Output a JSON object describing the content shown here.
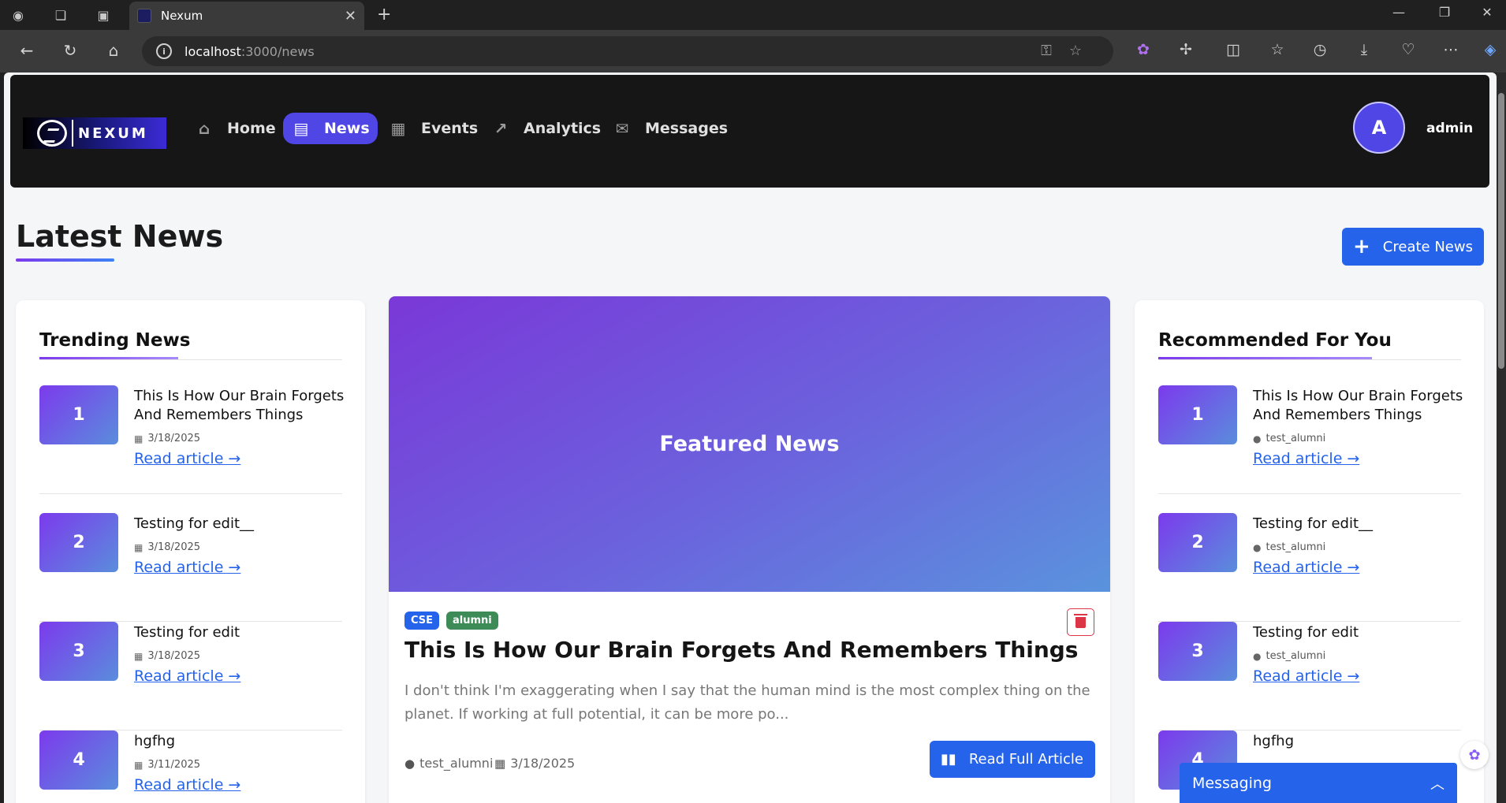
{
  "browser": {
    "tab_title": "Nexum",
    "tab_close": "✕",
    "new_tab": "+",
    "url_host": "localhost",
    "url_path": ":3000/news",
    "win_min": "—",
    "win_max": "❐",
    "win_close": "✕"
  },
  "nav": {
    "logo_text": "NEXUM",
    "items": [
      {
        "label": "Home",
        "icon": "home-icon",
        "glyph": "⌂"
      },
      {
        "label": "News",
        "icon": "newspaper-icon",
        "glyph": "▤"
      },
      {
        "label": "Events",
        "icon": "calendar-icon",
        "glyph": "▦"
      },
      {
        "label": "Analytics",
        "icon": "chart-line-icon",
        "glyph": "↗"
      },
      {
        "label": "Messages",
        "icon": "envelope-icon",
        "glyph": "✉"
      }
    ],
    "active": "News",
    "avatar_letter": "A",
    "username": "admin"
  },
  "page": {
    "title": "Latest News",
    "create_button": "Create News",
    "create_icon": "+"
  },
  "trending": {
    "title": "Trending News",
    "items": [
      {
        "rank": "1",
        "title": "This Is How Our Brain Forgets And Remembers Things",
        "meta": "3/18/2025",
        "link": "Read article →"
      },
      {
        "rank": "2",
        "title": "Testing for edit__",
        "meta": "3/18/2025",
        "link": "Read article →"
      },
      {
        "rank": "3",
        "title": "Testing for edit",
        "meta": "3/18/2025",
        "link": "Read article →"
      },
      {
        "rank": "4",
        "title": "hgfhg",
        "meta": "3/11/2025",
        "link": "Read article →"
      }
    ]
  },
  "featured": {
    "hero_label": "Featured News",
    "tags": [
      {
        "label": "CSE",
        "color": "#2563eb"
      },
      {
        "label": "alumni",
        "color": "#3d8b57"
      }
    ],
    "title": "This Is How Our Brain Forgets And Remembers Things",
    "excerpt": "I don't think I'm exaggerating when I say that the human mind is the most complex thing on the planet. If working at full potential, it can be more po...",
    "author": "test_alumni",
    "date": "3/18/2025",
    "read_button": "Read Full Article"
  },
  "recommended": {
    "title": "Recommended For You",
    "items": [
      {
        "rank": "1",
        "title": "This Is How Our Brain Forgets And Remembers Things",
        "meta": "test_alumni",
        "link": "Read article →"
      },
      {
        "rank": "2",
        "title": "Testing for edit__",
        "meta": "test_alumni",
        "link": "Read article →"
      },
      {
        "rank": "3",
        "title": "Testing for edit",
        "meta": "test_alumni",
        "link": "Read article →"
      },
      {
        "rank": "4",
        "title": "hgfhg",
        "meta": "",
        "link": ""
      }
    ]
  },
  "messaging": {
    "label": "Messaging",
    "chevron": "︿"
  },
  "colors": {
    "accent": "#4f46e5",
    "primary_button": "#2563eb",
    "danger": "#dc3545"
  }
}
